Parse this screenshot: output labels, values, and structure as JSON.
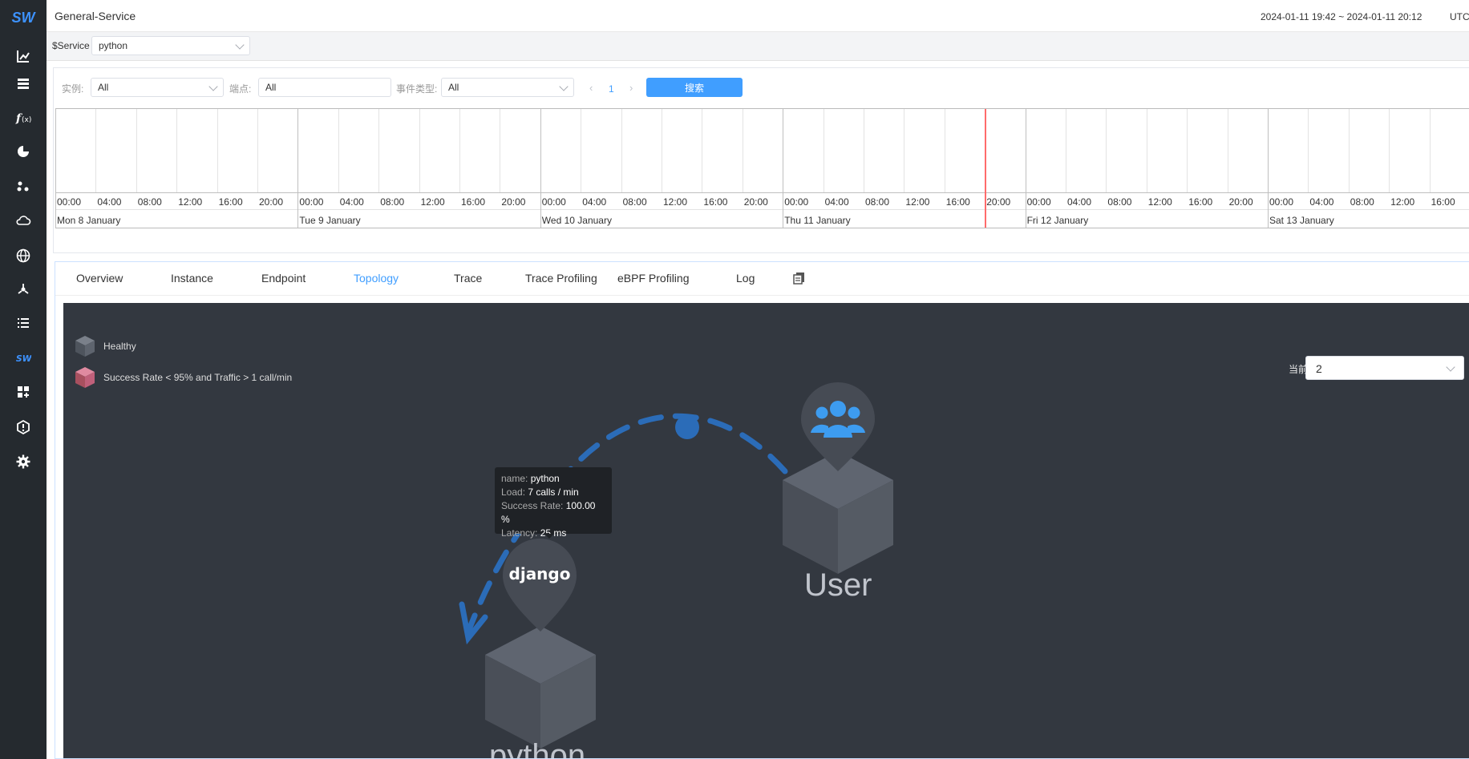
{
  "sidebar": {
    "logo": "SW",
    "items": [
      {
        "name": "general-service"
      },
      {
        "name": "database"
      },
      {
        "name": "function"
      },
      {
        "name": "infrastructure"
      },
      {
        "name": "service-mesh"
      },
      {
        "name": "cloud"
      },
      {
        "name": "browser"
      },
      {
        "name": "kubernetes"
      },
      {
        "name": "list"
      },
      {
        "name": "skywalking"
      },
      {
        "name": "dashboard-add"
      },
      {
        "name": "alerting"
      },
      {
        "name": "settings"
      }
    ]
  },
  "header": {
    "title": "General-Service",
    "time_range": "2024-01-11 19:42 ~ 2024-01-11 20:12",
    "timezone": "UTC"
  },
  "variables": {
    "label": "$Service",
    "service_value": "python"
  },
  "filters": {
    "instance_label": "实例:",
    "instance_value": "All",
    "endpoint_label": "端点:",
    "endpoint_value": "All",
    "event_type_label": "事件类型:",
    "event_type_value": "All",
    "page": "1",
    "search_label": "搜索"
  },
  "timeline": {
    "hours": [
      "00:00",
      "04:00",
      "08:00",
      "12:00",
      "16:00",
      "20:00"
    ],
    "days": [
      "Mon 8 January",
      "Tue 9 January",
      "Wed 10 January",
      "Thu 11 January",
      "Fri 12 January",
      "Sat 13 January"
    ]
  },
  "tabs": [
    {
      "label": "Overview"
    },
    {
      "label": "Instance"
    },
    {
      "label": "Endpoint"
    },
    {
      "label": "Topology",
      "active": true
    },
    {
      "label": "Trace"
    },
    {
      "label": "Trace Profiling"
    },
    {
      "label": "eBPF Profiling"
    },
    {
      "label": "Log"
    }
  ],
  "topology": {
    "legend": [
      {
        "label": "Healthy",
        "color": "#5b616b"
      },
      {
        "label": "Success Rate < 95% and Traffic > 1 call/min",
        "color": "#c0607a"
      }
    ],
    "depth_label": "当前深度",
    "depth_value": "2",
    "nodes": [
      {
        "name": "User",
        "icon": "user-group-icon"
      },
      {
        "name": "python",
        "icon": "django-icon",
        "icon_text": "django"
      }
    ],
    "tooltip": {
      "name_label": "name:",
      "name_value": "python",
      "load_label": "Load:",
      "load_value": "7 calls / min",
      "success_label": "Success Rate:",
      "success_value": "100.00 %",
      "latency_label": "Latency:",
      "latency_value": "25 ms"
    }
  },
  "colors": {
    "sidebar_bg": "#252a2f",
    "accent": "#409eff",
    "topology_bg": "#333840",
    "current_time_marker": "#ff6b6b"
  }
}
